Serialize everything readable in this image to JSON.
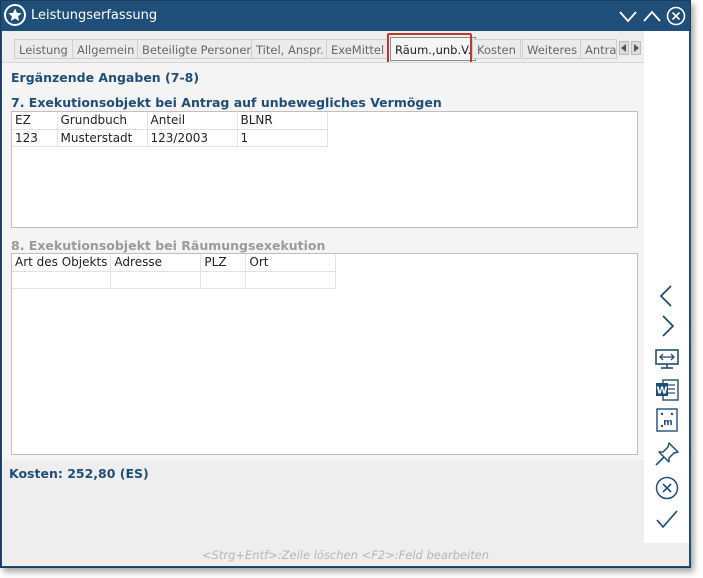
{
  "window": {
    "title": "Leistungserfassung",
    "icon": "star-icon",
    "controls": [
      "minimize-chevron-icon",
      "maximize-chevron-icon",
      "close-circle-icon"
    ]
  },
  "tabs": [
    {
      "label": "Leistung",
      "active": false
    },
    {
      "label": "Allgemein",
      "active": false
    },
    {
      "label": "Beteiligte Personen",
      "active": false
    },
    {
      "label": "Titel, Anspr.",
      "active": false
    },
    {
      "label": "ExeMittel",
      "active": false
    },
    {
      "label": "Räum.,unb.V.",
      "active": true
    },
    {
      "label": "Kosten",
      "active": false
    },
    {
      "label": "Weiteres",
      "active": false
    },
    {
      "label": "Antra",
      "active": false
    }
  ],
  "colors": {
    "accent": "#1f4e79",
    "highlight_border": "#c0392b"
  },
  "page": {
    "heading": "Ergänzende Angaben (7-8)",
    "section7": {
      "title": "7. Exekutionsobjekt bei Antrag auf unbewegliches Vermögen",
      "columns": [
        "EZ",
        "Grundbuch",
        "Anteil",
        "BLNR"
      ],
      "rows": [
        [
          "123",
          "Musterstadt",
          "123/2003",
          "1"
        ]
      ]
    },
    "section8": {
      "title": "8. Exekutionsobjekt bei Räumungsexekution",
      "columns": [
        "Art des Objekts",
        "Adresse",
        "PLZ",
        "Ort"
      ],
      "rows": [
        [
          "",
          "",
          "",
          ""
        ]
      ]
    },
    "costs": "Kosten: 252,80 (ES)",
    "hint": "<Strg+Entf>:Zeile löschen  <F2>:Feld bearbeiten"
  },
  "sidebar": [
    "back-chevron-icon",
    "forward-chevron-icon",
    "screen-resize-icon",
    "word-document-icon",
    "template-m-icon",
    "pin-icon",
    "cancel-circle-icon",
    "confirm-check-icon"
  ]
}
